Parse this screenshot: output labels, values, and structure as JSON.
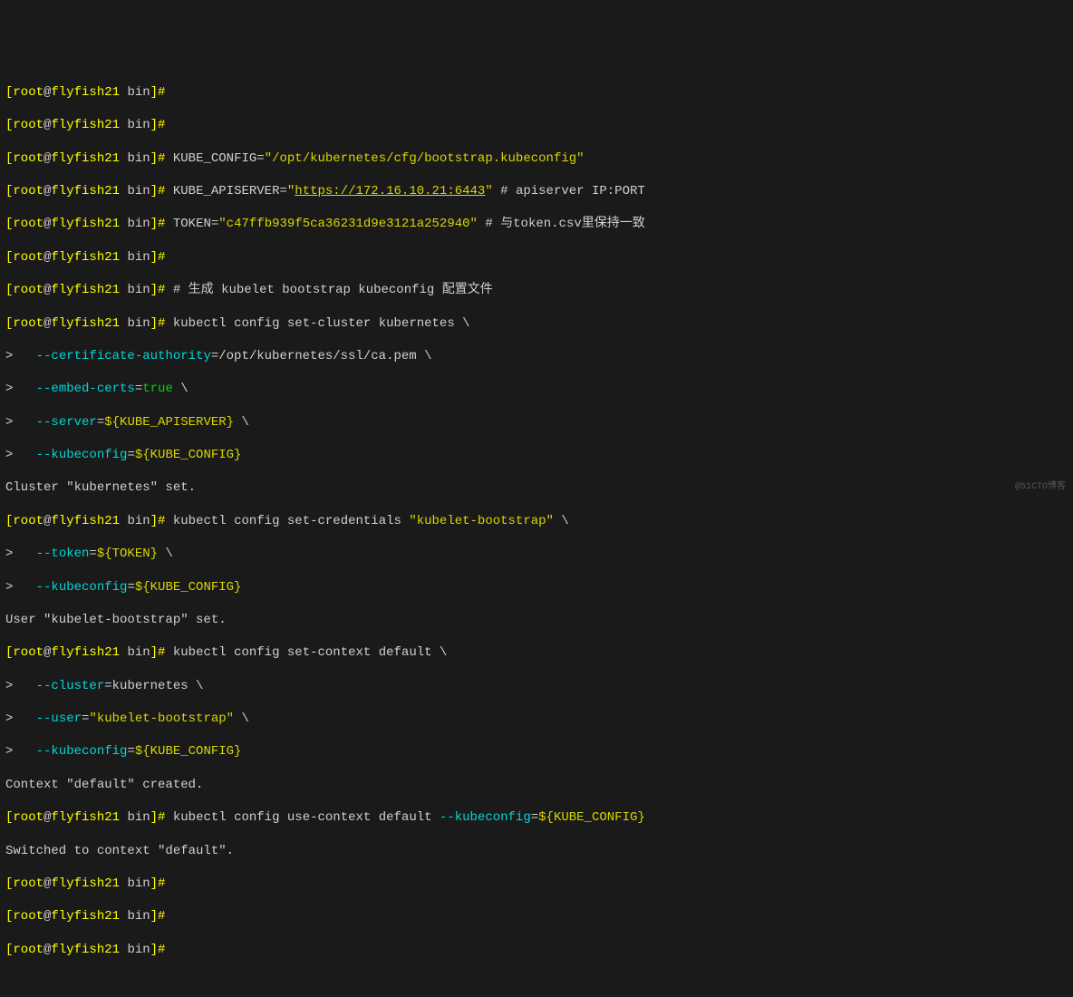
{
  "prompt": {
    "open": "[",
    "user": "root",
    "at": "@",
    "host": "flyfish21",
    "path": " bin",
    "close": "]#"
  },
  "cont": ">   ",
  "lines": {
    "l0": "",
    "l1": "",
    "l2_cmd": " KUBE_CONFIG=",
    "l2_str": "\"/opt/kubernetes/cfg/bootstrap.kubeconfig\"",
    "l3_cmd": " KUBE_APISERVER=",
    "l3_q1": "\"",
    "l3_url": "https://172.16.10.21:6443",
    "l3_q2": "\"",
    "l3_comment": " # apiserver IP:PORT",
    "l4_cmd": " TOKEN=",
    "l4_str": "\"c47ffb939f5ca36231d9e3121a252940\"",
    "l4_comment": " # 与token.csv里保持一致",
    "l5": "",
    "l6_cmd": " # 生成 kubelet bootstrap kubeconfig 配置文件",
    "l7_cmd": " kubectl config set-cluster kubernetes \\",
    "l8_flag": "--certificate-authority",
    "l8_eq": "=/opt/kubernetes/ssl/ca.pem \\",
    "l9_flag": "--embed-certs",
    "l9_eq": "=",
    "l9_val": "true",
    "l9_bs": " \\",
    "l10_flag": "--server",
    "l10_eq": "=",
    "l10_var": "${KUBE_APISERVER}",
    "l10_bs": " \\",
    "l11_flag": "--kubeconfig",
    "l11_eq": "=",
    "l11_var": "${KUBE_CONFIG}",
    "l12": "Cluster \"kubernetes\" set.",
    "l13_cmd": " kubectl config set-credentials ",
    "l13_str": "\"kubelet-bootstrap\"",
    "l13_bs": " \\",
    "l14_flag": "--token",
    "l14_eq": "=",
    "l14_var": "${TOKEN}",
    "l14_bs": " \\",
    "l15_flag": "--kubeconfig",
    "l15_eq": "=",
    "l15_var": "${KUBE_CONFIG}",
    "l16": "User \"kubelet-bootstrap\" set.",
    "l17_cmd": " kubectl config set-context default \\",
    "l18_flag": "--cluster",
    "l18_eq": "=kubernetes \\",
    "l19_flag": "--user",
    "l19_eq": "=",
    "l19_str": "\"kubelet-bootstrap\"",
    "l19_bs": " \\",
    "l20_flag": "--kubeconfig",
    "l20_eq": "=",
    "l20_var": "${KUBE_CONFIG}",
    "l21": "Context \"default\" created.",
    "l22_cmd": " kubectl config use-context default ",
    "l22_flag": "--kubeconfig",
    "l22_eq": "=",
    "l22_var": "${KUBE_CONFIG}",
    "l23": "Switched to context \"default\".",
    "l24": "",
    "l25": "",
    "l26": ""
  },
  "watermark": "@51CTO博客"
}
